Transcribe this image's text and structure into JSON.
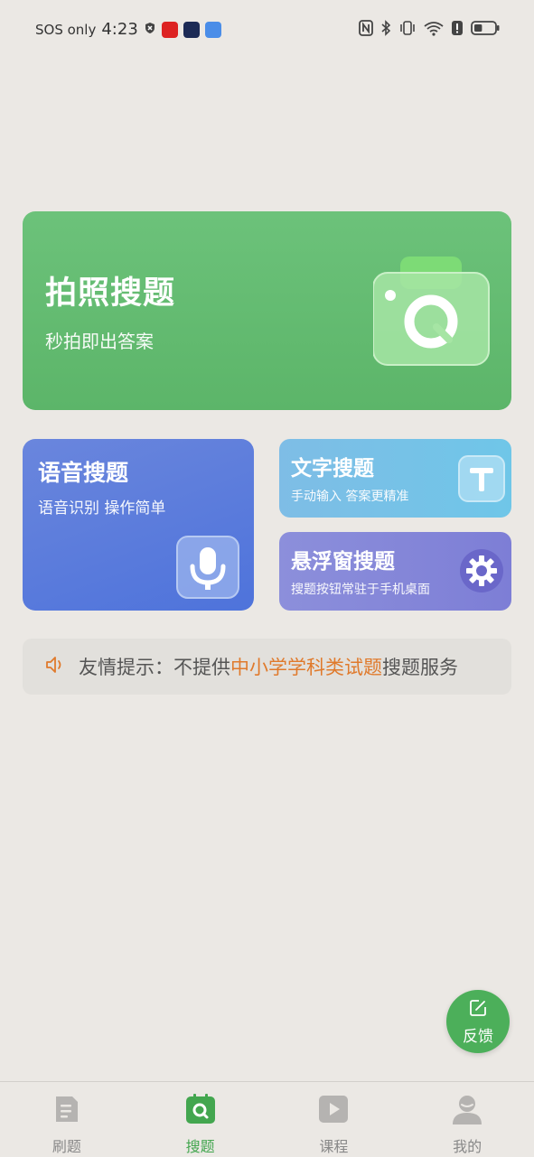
{
  "status_bar": {
    "carrier": "SOS only",
    "time": "4:23",
    "battery_level": 0.4
  },
  "photo_search": {
    "title": "拍照搜题",
    "subtitle": "秒拍即出答案",
    "icon": "camera-search-icon",
    "color": "#62bb70"
  },
  "voice_search": {
    "title": "语音搜题",
    "subtitle": "语音识别 操作简单",
    "icon": "microphone-icon",
    "color": "#5679dc"
  },
  "text_search": {
    "title": "文字搜题",
    "subtitle": "手动输入 答案更精准",
    "icon": "text-t-icon",
    "color": "#76c1e7"
  },
  "float_search": {
    "title": "悬浮窗搜题",
    "subtitle": "搜题按钮常驻于手机桌面",
    "icon": "gear-icon",
    "color": "#8486d8"
  },
  "notice": {
    "prefix": "友情提示：不提供",
    "highlight": "中小学学科类试题",
    "suffix": "搜题服务",
    "highlight_color": "#e07a2c"
  },
  "feedback": {
    "label": "反馈",
    "icon": "edit-icon"
  },
  "tabs": [
    {
      "label": "刷题",
      "icon": "document-icon",
      "active": false
    },
    {
      "label": "搜题",
      "icon": "search-icon",
      "active": true
    },
    {
      "label": "课程",
      "icon": "play-icon",
      "active": false
    },
    {
      "label": "我的",
      "icon": "user-icon",
      "active": false
    }
  ],
  "accent_color": "#43a64f"
}
